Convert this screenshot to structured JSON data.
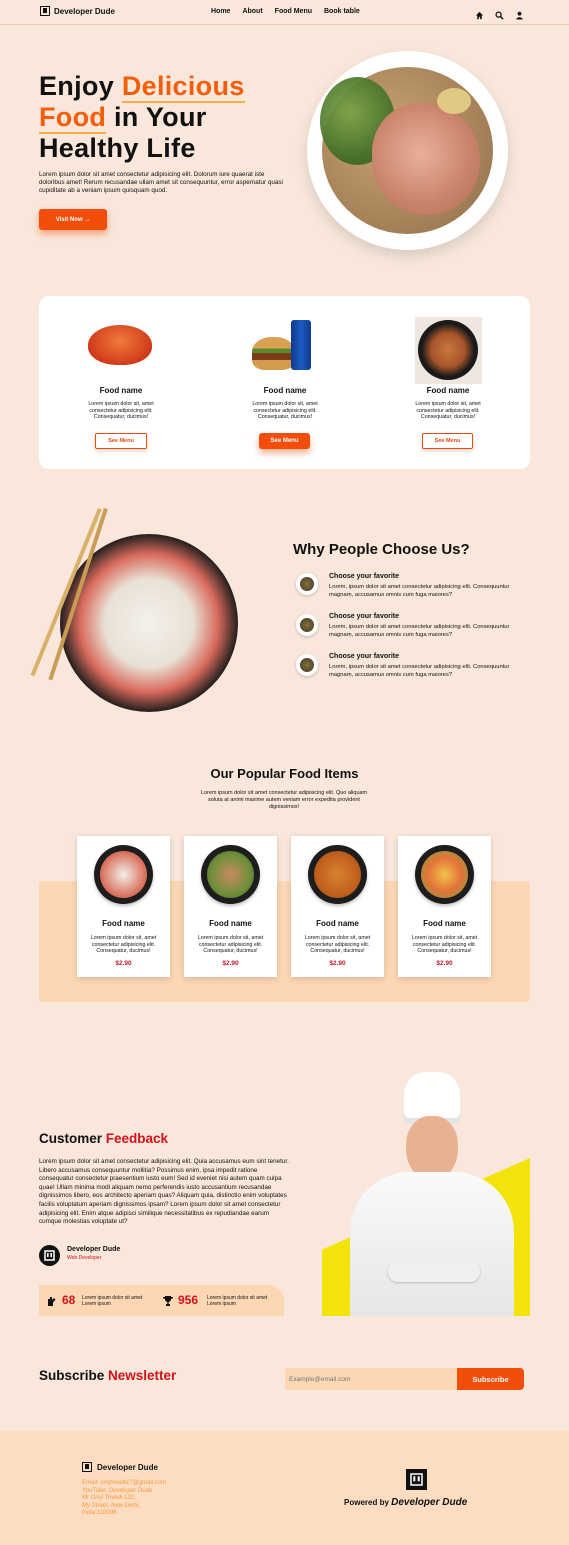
{
  "nav": {
    "brand": "Developer Dude",
    "links": [
      "Home",
      "About",
      "Food Menu",
      "Book table"
    ],
    "icons": [
      "home-icon",
      "search-icon",
      "user-icon"
    ]
  },
  "hero": {
    "title_1": "Enjoy ",
    "title_hl_1": "Delicious",
    "title_hl_2": "Food",
    "title_2": " in Your",
    "title_3": "Healthy Life",
    "text": "Lorem ipsum dolor sit amet consectetur adipisicing elit. Dolorum iure quaerat iste doloribus amet! Rerum recusandae ullam amet sit consequuntur, error aspernatur quasi cupiditate ab a veniam ipsum quisquam quod.",
    "button": "Visit Now →"
  },
  "menu_cards": [
    {
      "name": "Food name",
      "desc": "Lorem ipsum dolor sit, amet consectetur adipisicing elit. Consequatur, ducimus!",
      "button": "See Menu",
      "active": false
    },
    {
      "name": "Food name",
      "desc": "Lorem ipsum dolor sit, amet consectetur adipisicing elit. Consequatur, ducimus!",
      "button": "See Menu",
      "active": true
    },
    {
      "name": "Food name",
      "desc": "Lorem ipsum dolor sit, amet consectetur adipisicing elit. Consequatur, ducimus!",
      "button": "See Menu",
      "active": false
    }
  ],
  "why": {
    "title": "Why People Choose Us?",
    "items": [
      {
        "title": "Choose your favorite",
        "text": "Lorem, ipsum dolor sit amet consectetur adipisicing elit. Consequuntur magnam, accusamus omnis cum fuga maiores?"
      },
      {
        "title": "Choose your favorite",
        "text": "Lorem, ipsum dolor sit amet consectetur adipisicing elit. Consequuntur magnam, accusamus omnis cum fuga maiores?"
      },
      {
        "title": "Choose your favorite",
        "text": "Lorem, ipsum dolor sit amet consectetur adipisicing elit. Consequuntur magnam, accusamus omnis cum fuga maiores?"
      }
    ]
  },
  "popular": {
    "title": "Our Popular Food Items",
    "subtitle": "Lorem ipsum dolor sit amet consectetur adipisicing elit. Quo aliquam soluta at animi maxime autem veniam error expedita provident dignissimos!",
    "items": [
      {
        "name": "Food name",
        "desc": "Lorem ipsum dolor sit, amet consectetur adipisicing elit. Consequatur, ducimus!",
        "price": "$2.90"
      },
      {
        "name": "Food name",
        "desc": "Lorem ipsum dolor sit, amet consectetur adipisicing elit. Consequatur, ducimus!",
        "price": "$2.90"
      },
      {
        "name": "Food name",
        "desc": "Lorem ipsum dolor sit, amet consectetur adipisicing elit. Consequatur, ducimus!",
        "price": "$2.90"
      },
      {
        "name": "Food name",
        "desc": "Lorem ipsum dolor sit, amet consectetur adipisicing elit. Consequatur, ducimus!",
        "price": "$2.90"
      }
    ]
  },
  "feedback": {
    "title_1": "Customer ",
    "title_2": "Feedback",
    "text": "Lorem ipsum dolor sit amet consectetur adipisicing elit. Quia accusamus eum sint tenetur. Libero accusamus consequuntur mollitia? Possimus enim, ipsa impedit ratione consequatur consectetur praesentium iusto eum! Sed id eveniet nisi autem quam culpa quae! Ullam minima modi aliquam nemo perferendis iusto accusantium recusandae dignissimos libero, eos architecto aperiam quas? Aliquam quia, distinctio enim voluptates facilis voluptatum aperiam dignissimos ipsam? Lorem ipsum dolor sit amet consectetur adipisicing elit. Enim atque adipisci similique necessitatibus ex repudiandae earum cumque molestias voluptate ut?",
    "author": "Developer Dude",
    "role": "Web Developer",
    "stats": [
      {
        "number": "68",
        "label": "Lorem ipsum dolor sit amet Lorem ipsum"
      },
      {
        "number": "956",
        "label": "Lorem ipsum dolor sit amet Lorem ipsum"
      }
    ]
  },
  "subscribe": {
    "title_1": "Subscribe ",
    "title_2": "Newsletter",
    "placeholder": "Example@email.com",
    "button": "Subscribe"
  },
  "footer": {
    "brand": "Developer Dude",
    "info": [
      "Email: omjtrivedi17@gmail.com",
      "YouTube: Developer Dude",
      "Mr Omji Trivedi 132,",
      "My Street, New Delhi,",
      "India 110006."
    ],
    "powered_prefix": "Powered by ",
    "powered_name": "Developer Dude"
  },
  "colors": {
    "accent": "#f24d0b",
    "red": "#d5111b",
    "background": "#f8e7da",
    "panel": "#fcd7b4"
  }
}
